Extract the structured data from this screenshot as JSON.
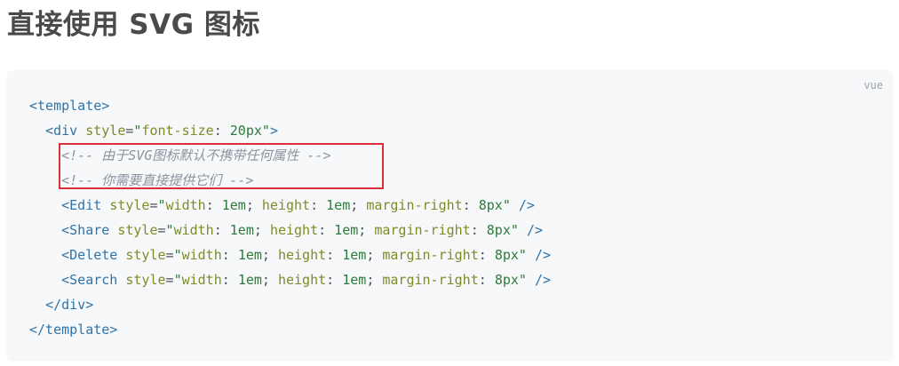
{
  "heading": "直接使用 SVG 图标",
  "code_block": {
    "language": "vue",
    "lines": {
      "l1": {
        "open": "<template>"
      },
      "l2": {
        "tag": "<div",
        "attr": "style",
        "eq": "=",
        "q1": "\"",
        "css_prop": "font-size",
        "colon": ":",
        "css_val": "20px",
        "q2": "\"",
        "close": ">"
      },
      "l3": {
        "comment": "<!-- 由于SVG图标默认不携带任何属性 -->"
      },
      "l4": {
        "comment": "<!-- 你需要直接提供它们 -->"
      },
      "l5": {
        "tag": "<Edit",
        "attr": "style",
        "eq": "=",
        "q1": "\"",
        "p1": "width",
        "c1": ":",
        "v1": "1em",
        "s1": ";",
        "p2": "height",
        "c2": ":",
        "v2": "1em",
        "s2": ";",
        "p3": "margin-right",
        "c3": ":",
        "v3": "8px",
        "q2": "\"",
        "close": "/>"
      },
      "l6": {
        "tag": "<Share",
        "attr": "style",
        "eq": "=",
        "q1": "\"",
        "p1": "width",
        "c1": ":",
        "v1": "1em",
        "s1": ";",
        "p2": "height",
        "c2": ":",
        "v2": "1em",
        "s2": ";",
        "p3": "margin-right",
        "c3": ":",
        "v3": "8px",
        "q2": "\"",
        "close": "/>"
      },
      "l7": {
        "tag": "<Delete",
        "attr": "style",
        "eq": "=",
        "q1": "\"",
        "p1": "width",
        "c1": ":",
        "v1": "1em",
        "s1": ";",
        "p2": "height",
        "c2": ":",
        "v2": "1em",
        "s2": ";",
        "p3": "margin-right",
        "c3": ":",
        "v3": "8px",
        "q2": "\"",
        "close": "/>"
      },
      "l8": {
        "tag": "<Search",
        "attr": "style",
        "eq": "=",
        "q1": "\"",
        "p1": "width",
        "c1": ":",
        "v1": "1em",
        "s1": ";",
        "p2": "height",
        "c2": ":",
        "v2": "1em",
        "s2": ";",
        "p3": "margin-right",
        "c3": ":",
        "v3": "8px",
        "q2": "\"",
        "close": "/>"
      },
      "l9": {
        "close": "</div>"
      },
      "l10": {
        "close": "</template>"
      }
    }
  },
  "colors": {
    "tag": "#2f73a7",
    "attribute": "#7a8d26",
    "string": "#2d7b3a",
    "comment": "#8b949e",
    "highlight_border": "#d9303a",
    "code_background": "#f7f8fa"
  }
}
